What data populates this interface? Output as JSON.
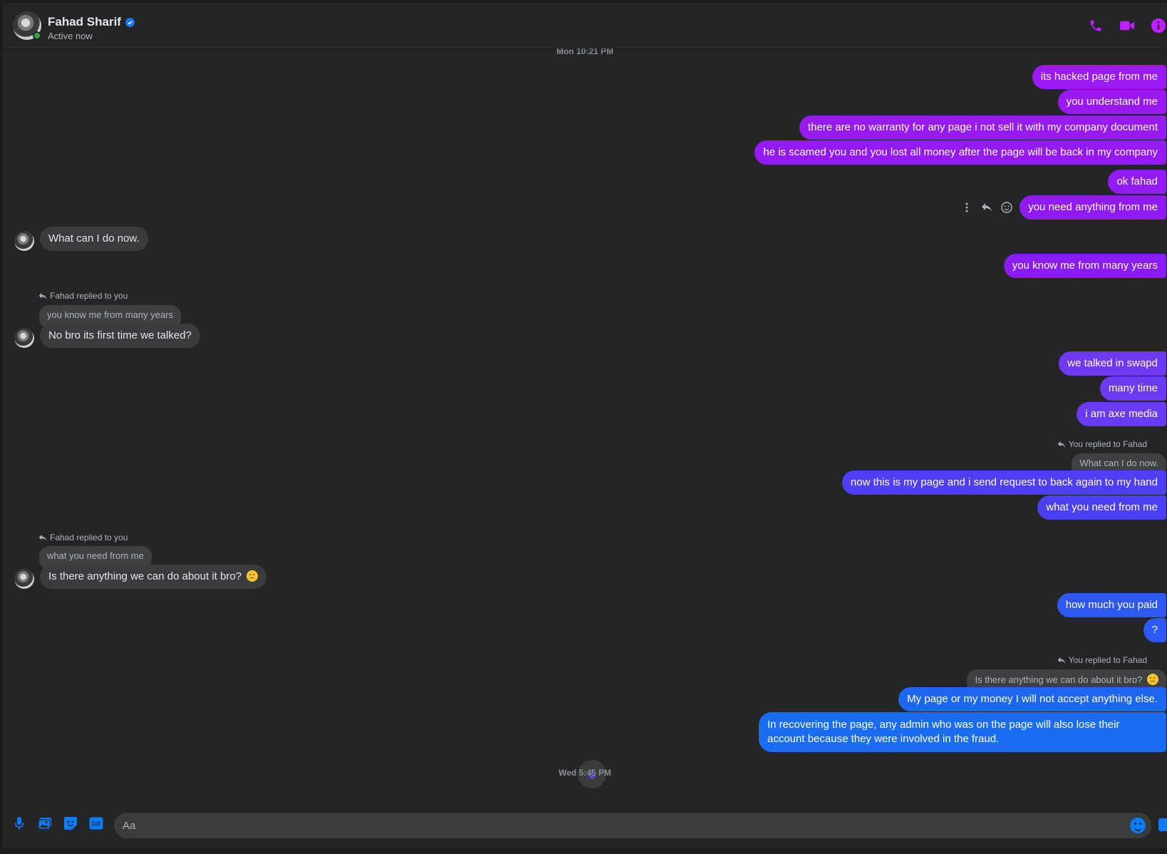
{
  "header": {
    "name": "Fahad Sharif",
    "status": "Active now",
    "icons": [
      "phone-icon",
      "video-icon",
      "info-icon"
    ],
    "accent": "#c020ff"
  },
  "thread": {
    "timestamp_top": "Mon 10:21 PM",
    "timestamp_bottom": "Wed 5:45 PM",
    "out_1": "its hacked page from me",
    "out_2": "you understand me",
    "out_3": "there are no warranty for any page i not sell it with my company document",
    "out_4": "he is scamed you and you lost all money after the page will be back in my company",
    "out_5": "ok fahad",
    "out_6": "you need anything from me",
    "in_1": "What can I do now.",
    "out_7": "you know me from many years",
    "reply_label_1": "Fahad replied to you",
    "quoted_1": "you know me from many years",
    "in_2": "No bro its first time we talked?",
    "out_8": "we talked in swapd",
    "out_9": "many time",
    "out_10": "i am axe media",
    "reply_label_2": "You replied to Fahad",
    "quoted_2": "What can I do now.",
    "out_11": "now this is my page and i send request to back again to my hand",
    "out_12": "what you need from me",
    "reply_label_3": "Fahad replied to you",
    "quoted_3": "what you need from me",
    "in_3": "Is there anything we can do about it bro?",
    "out_13": "how much you paid",
    "out_14": "?",
    "reply_label_4": "You replied to Fahad",
    "quoted_4": "Is there anything we can do about it bro?",
    "out_15": "My page or my money I will not accept anything else.",
    "out_16": "In recovering the page, any admin who was on the page will also lose their account because they were involved in the fraud.",
    "colors": {
      "purple": "#9d19f1",
      "violet": "#6c3bf1",
      "indigo": "#4a3ff3",
      "blue": "#1a6cf0"
    }
  },
  "composer": {
    "placeholder": "Aa",
    "icons": [
      "microphone-icon",
      "photo-icon",
      "sticker-icon",
      "gif-icon",
      "emoji-icon",
      "like-icon"
    ],
    "gif_label": "GIF"
  }
}
